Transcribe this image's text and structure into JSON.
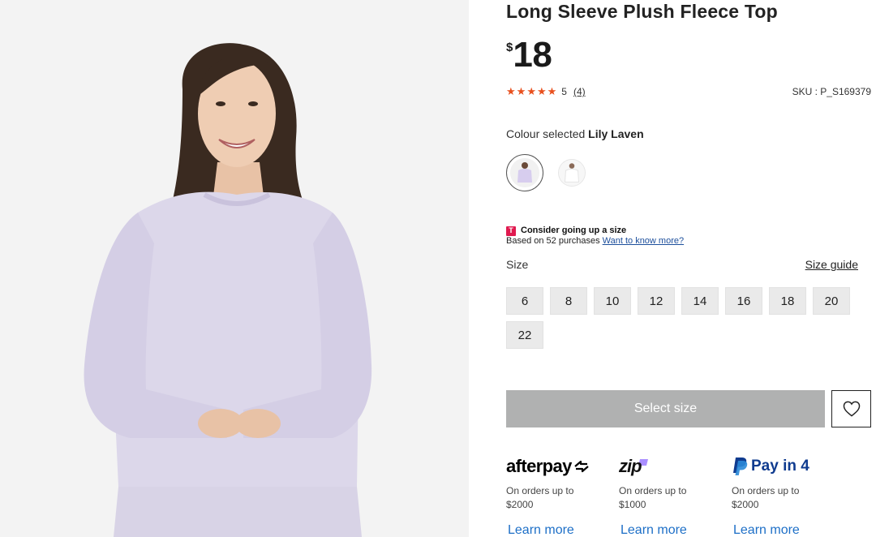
{
  "product": {
    "title": "Long Sleeve Plush Fleece Top",
    "currency_symbol": "$",
    "price": "18",
    "rating_value": "5",
    "rating_count": "(4)",
    "rating_stars": 5,
    "sku": "SKU : P_S169379",
    "colour_label": "Colour selected ",
    "colour_name": "Lily Laven",
    "colours": [
      "Lily Laven",
      "White"
    ]
  },
  "size_advice": {
    "brand_letter": "T",
    "heading": "Consider going up a size",
    "detail": "Based on 52 purchases ",
    "link": "Want to know more?"
  },
  "sizes": {
    "label": "Size",
    "guide_label": "Size guide",
    "options": [
      "6",
      "8",
      "10",
      "12",
      "14",
      "16",
      "18",
      "20",
      "22"
    ]
  },
  "actions": {
    "select_size": "Select size",
    "wishlist_icon": "heart-icon"
  },
  "payments": [
    {
      "name": "afterpay",
      "terms_line1": "On orders up to",
      "terms_line2": "$2000",
      "learn": "Learn more"
    },
    {
      "name": "zip",
      "terms_line1": "On orders up to",
      "terms_line2": "$1000",
      "learn": "Learn more"
    },
    {
      "name": "Pay in 4",
      "terms_line1": "On orders up to",
      "terms_line2": "$2000",
      "learn": "Learn more"
    }
  ],
  "colors": {
    "rating_star": "#e8501e",
    "select_size_bg": "#b0b1b1",
    "link_blue": "#1d6fc7",
    "sweater": "#dcd7ea",
    "paypal_blue": "#0f3b8f",
    "zip_purple": "#aa8fff"
  }
}
